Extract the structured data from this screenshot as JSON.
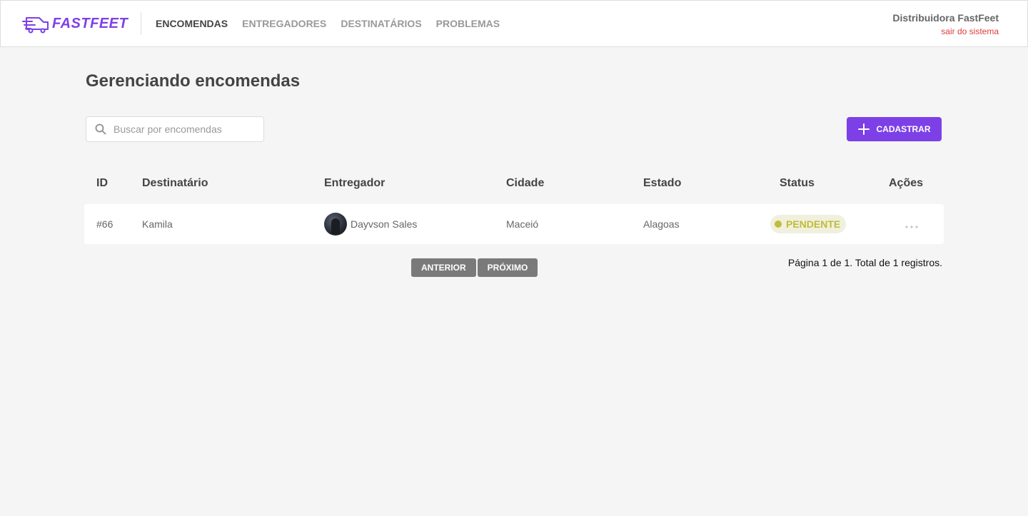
{
  "app": {
    "logo_text": "FASTFEET",
    "brand_color": "#7d40e7"
  },
  "nav": {
    "items": [
      {
        "label": "ENCOMENDAS",
        "active": true
      },
      {
        "label": "ENTREGADORES",
        "active": false
      },
      {
        "label": "DESTINATÁRIOS",
        "active": false
      },
      {
        "label": "PROBLEMAS",
        "active": false
      }
    ]
  },
  "profile": {
    "name": "Distribuidora FastFeet",
    "logout_label": "sair do sistema"
  },
  "page": {
    "title": "Gerenciando encomendas"
  },
  "search": {
    "placeholder": "Buscar por encomendas",
    "value": ""
  },
  "toolbar": {
    "add_label": "CADASTRAR"
  },
  "table": {
    "columns": [
      "ID",
      "Destinatário",
      "Entregador",
      "Cidade",
      "Estado",
      "Status",
      "Ações"
    ],
    "rows": [
      {
        "id": "#66",
        "recipient": "Kamila",
        "deliveryman": "Dayvson Sales",
        "city": "Maceió",
        "state": "Alagoas",
        "status": "PENDENTE",
        "status_color": "#c1bc35",
        "actions_icon": "more-horizontal-icon"
      }
    ]
  },
  "pagination": {
    "prev_label": "ANTERIOR",
    "next_label": "PRÓXIMO",
    "info": "Página 1 de 1. Total de 1 registros."
  }
}
